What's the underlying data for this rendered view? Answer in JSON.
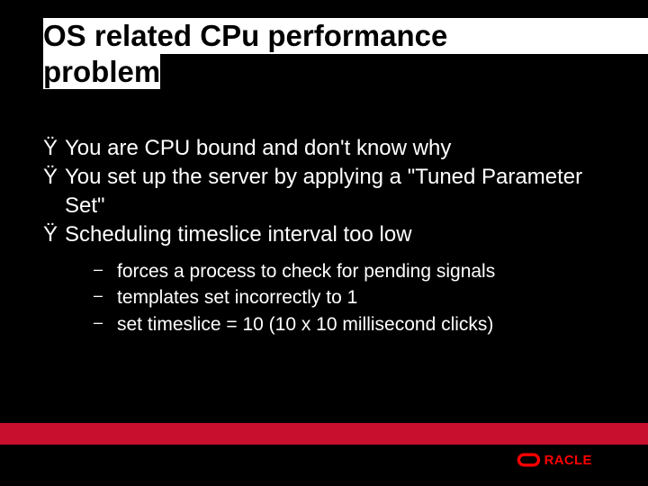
{
  "title_line1": "OS related CPu performance",
  "title_line2": "problem",
  "bullets": [
    {
      "mark": "Ÿ",
      "text": "You are CPU bound and don't know why"
    },
    {
      "mark": "Ÿ",
      "text": "You set up the server by applying a \"Tuned Parameter Set\""
    },
    {
      "mark": "Ÿ",
      "text": "Scheduling timeslice interval too low"
    }
  ],
  "sub_bullets": [
    {
      "mark": "–",
      "text": "forces a process to check for pending signals"
    },
    {
      "mark": "–",
      "text": "templates set incorrectly to 1"
    },
    {
      "mark": "–",
      "text": "set timeslice = 10 (10 x 10 millisecond clicks)"
    }
  ],
  "brand": {
    "name": "ORACLE",
    "bar_color": "#c8102e",
    "logo_text_color": "#ff1a1a"
  }
}
